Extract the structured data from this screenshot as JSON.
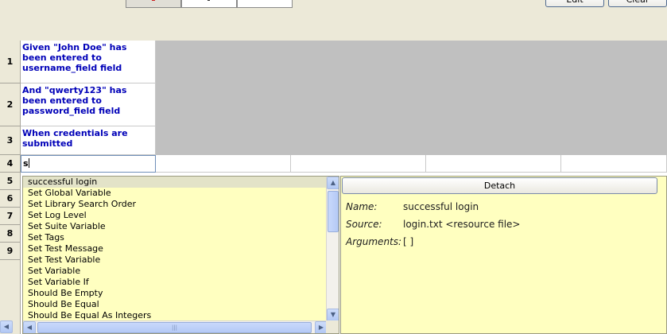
{
  "toolbar": {
    "edit_label": "Edit",
    "clear_label": "Clear"
  },
  "grid": {
    "rows": [
      {
        "num": "1",
        "text": "Given \"John Doe\" has been entered to username_field field"
      },
      {
        "num": "2",
        "text": "And \"qwerty123\" has been entered to password_field field"
      },
      {
        "num": "3",
        "text": "When credentials are submitted"
      },
      {
        "num": "4",
        "text": "s"
      },
      {
        "num": "5",
        "text": ""
      },
      {
        "num": "6",
        "text": ""
      },
      {
        "num": "7",
        "text": ""
      },
      {
        "num": "8",
        "text": ""
      },
      {
        "num": "9",
        "text": ""
      }
    ]
  },
  "autocomplete": {
    "items": [
      "successful login",
      "Set Global Variable",
      "Set Library Search Order",
      "Set Log Level",
      "Set Suite Variable",
      "Set Tags",
      "Set Test Message",
      "Set Test Variable",
      "Set Variable",
      "Set Variable If",
      "Should Be Empty",
      "Should Be Equal",
      "Should Be Equal As Integers"
    ]
  },
  "details": {
    "detach_label": "Detach",
    "name_key": "Name:",
    "name_value": "successful login",
    "source_key": "Source:",
    "source_value": "login.txt <resource file>",
    "arguments_key": "Arguments:",
    "arguments_value": "[ ]"
  },
  "colors": {
    "step_text": "#0000b8",
    "popup_bg": "#ffffc0",
    "grid_gray": "#c0c0c0"
  }
}
